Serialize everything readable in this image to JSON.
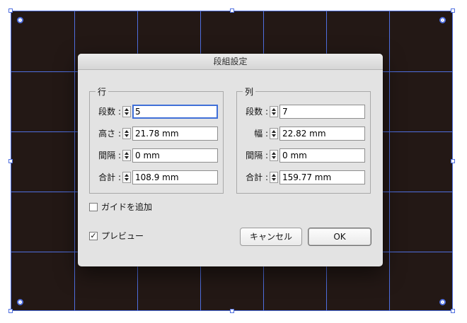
{
  "dialog": {
    "title": "段組設定",
    "rows_group": {
      "label": "行",
      "fields": [
        {
          "label": "段数 :",
          "value": "5"
        },
        {
          "label": "高さ :",
          "value": "21.78 mm"
        },
        {
          "label": "間隔 :",
          "value": "0 mm"
        },
        {
          "label": "合計 :",
          "value": "108.9 mm"
        }
      ]
    },
    "columns_group": {
      "label": "列",
      "fields": [
        {
          "label": "段数 :",
          "value": "7"
        },
        {
          "label": "幅 :",
          "value": "22.82 mm"
        },
        {
          "label": "間隔 :",
          "value": "0 mm"
        },
        {
          "label": "合計 :",
          "value": "159.77 mm"
        }
      ]
    },
    "add_guides": {
      "label": "ガイドを追加",
      "checked": false,
      "mark": ""
    },
    "preview": {
      "label": "プレビュー",
      "checked": true,
      "mark": "✓"
    },
    "cancel_label": "キャンセル",
    "ok_label": "OK"
  },
  "colors": {
    "artboard_fill": "#231815",
    "guide": "#4f6fe0",
    "focus_ring": "#3f6fd8",
    "dialog_bg": "#e3e3e3"
  }
}
